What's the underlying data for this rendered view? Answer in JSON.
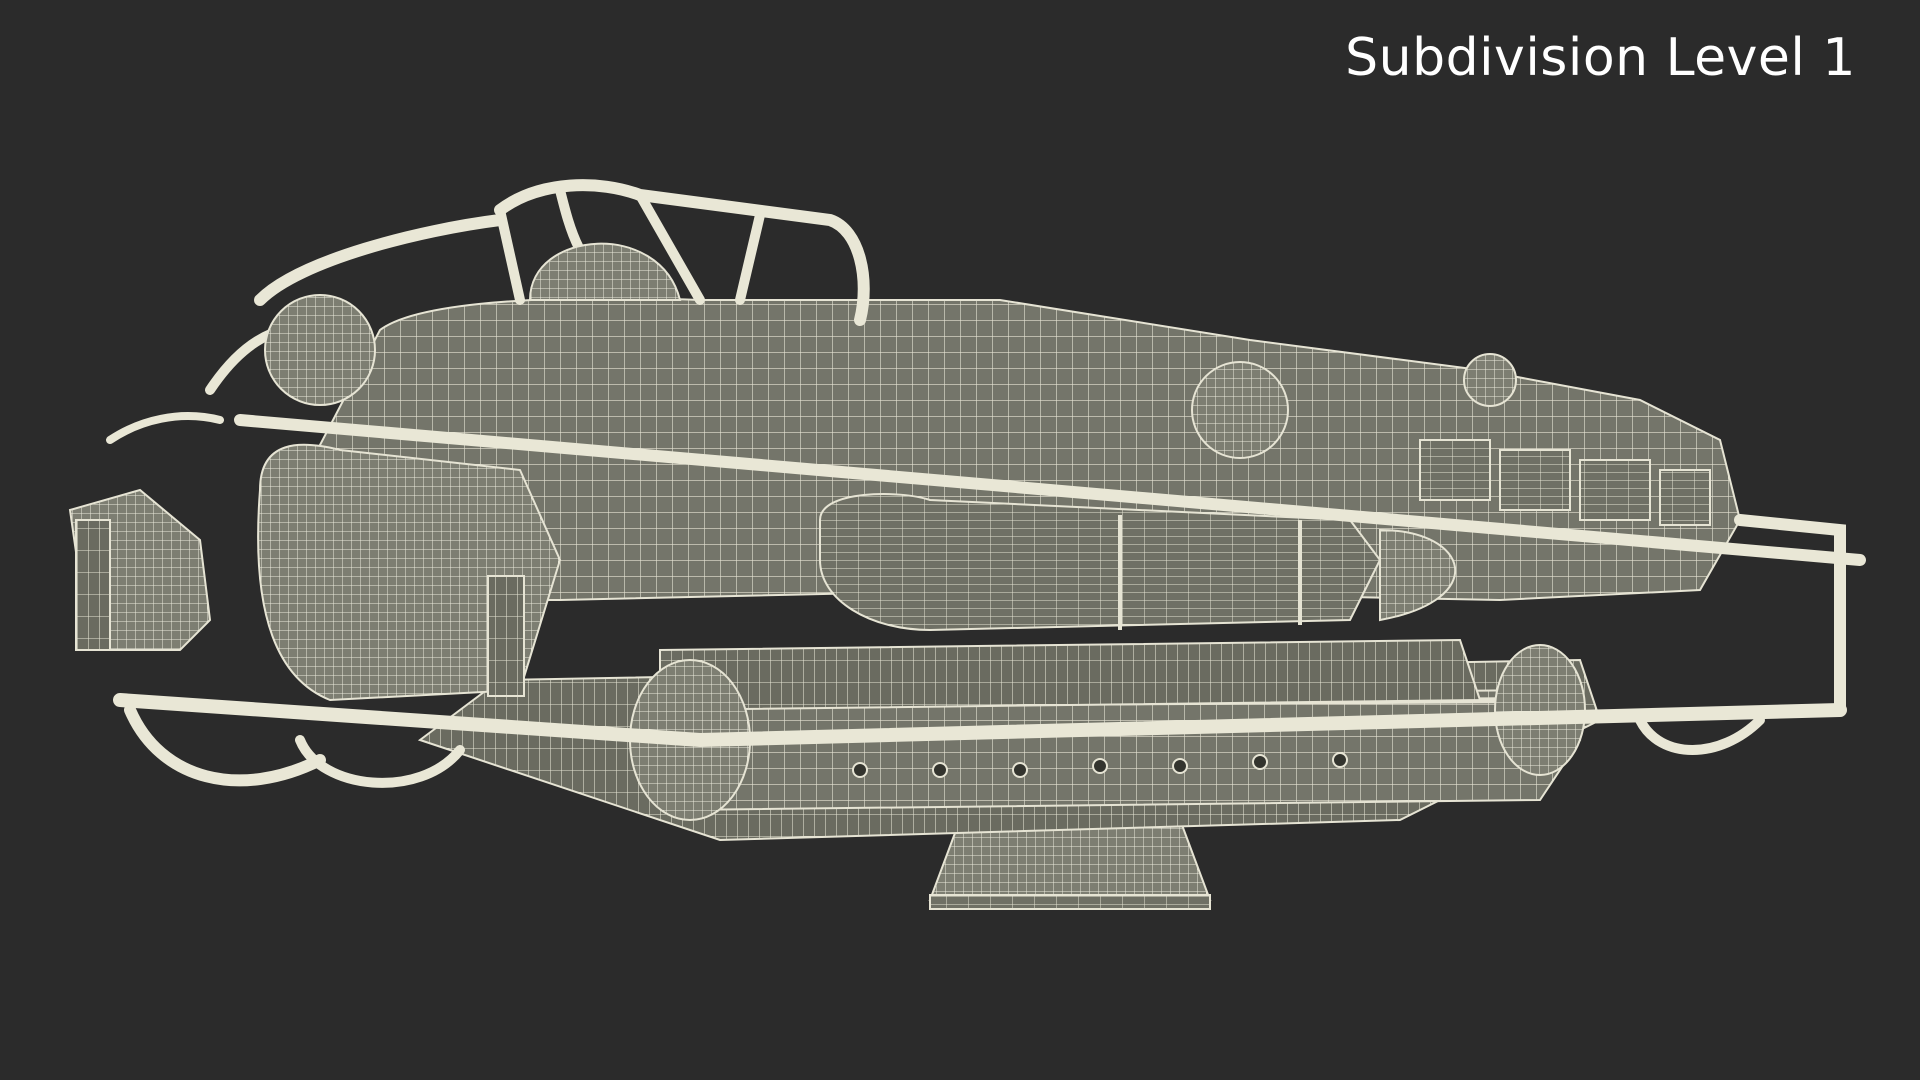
{
  "caption": {
    "text": "Subdivision Level 1"
  },
  "scene": {
    "subject": "wireframe-3d-model-render",
    "background_color": "#2b2b2b",
    "mesh_fill_color": "#76776a",
    "mesh_shade_color": "#5e5f55",
    "wire_color": "#e6e4d4"
  }
}
